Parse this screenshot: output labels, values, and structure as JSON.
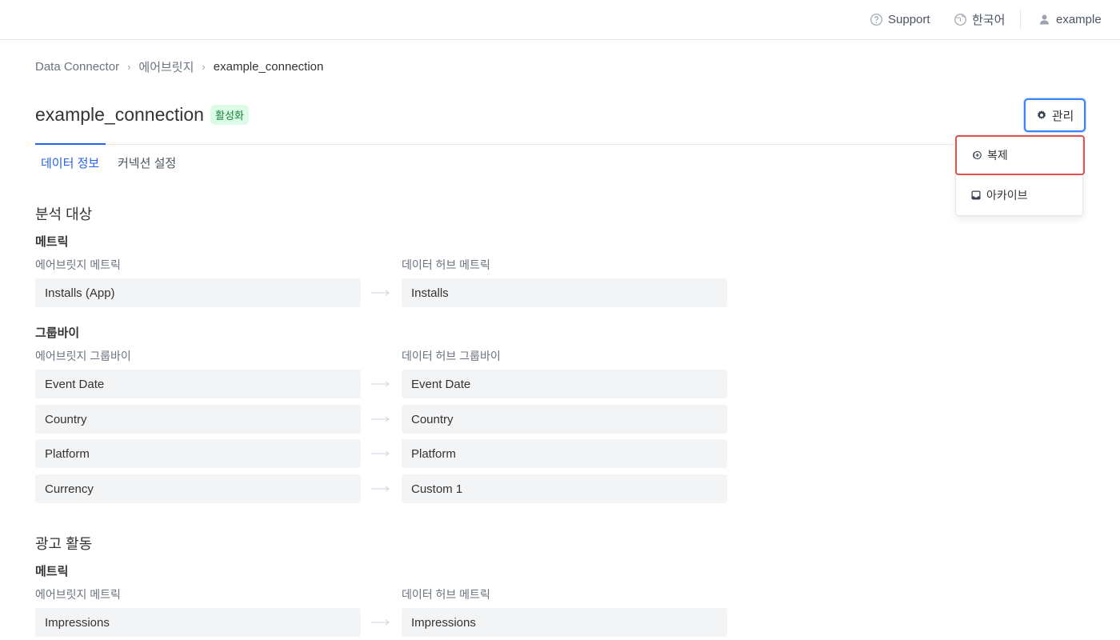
{
  "topbar": {
    "support": "Support",
    "language": "한국어",
    "user": "example"
  },
  "breadcrumb": {
    "items": [
      "Data Connector",
      "에어브릿지",
      "example_connection"
    ]
  },
  "page": {
    "title": "example_connection",
    "status_badge": "활성화",
    "manage_label": "관리"
  },
  "menu": {
    "items": [
      {
        "label": "복제",
        "icon": "duplicate-icon"
      },
      {
        "label": "아카이브",
        "icon": "archive-icon"
      }
    ]
  },
  "tabs": [
    {
      "label": "데이터 정보",
      "active": true
    },
    {
      "label": "커넥션 설정",
      "active": false
    }
  ],
  "sections": [
    {
      "title": "분석 대상",
      "metric": {
        "heading": "메트릭",
        "left_label": "에어브릿지 메트릭",
        "right_label": "데이터 허브 메트릭",
        "rows": [
          [
            "Installs (App)",
            "Installs"
          ]
        ]
      },
      "groupby": {
        "heading": "그룹바이",
        "left_label": "에어브릿지 그룹바이",
        "right_label": "데이터 허브 그룹바이",
        "rows": [
          [
            "Event Date",
            "Event Date"
          ],
          [
            "Country",
            "Country"
          ],
          [
            "Platform",
            "Platform"
          ],
          [
            "Currency",
            "Custom 1"
          ]
        ]
      }
    },
    {
      "title": "광고 활동",
      "metric": {
        "heading": "메트릭",
        "left_label": "에어브릿지 메트릭",
        "right_label": "데이터 허브 메트릭",
        "rows": [
          [
            "Impressions",
            "Impressions"
          ]
        ]
      }
    }
  ],
  "colors": {
    "accent": "#2563eb",
    "badge_text": "#15803d",
    "badge_bg": "#dcfce7",
    "highlight": "#e05252",
    "field_bg": "#f3f4f6"
  }
}
